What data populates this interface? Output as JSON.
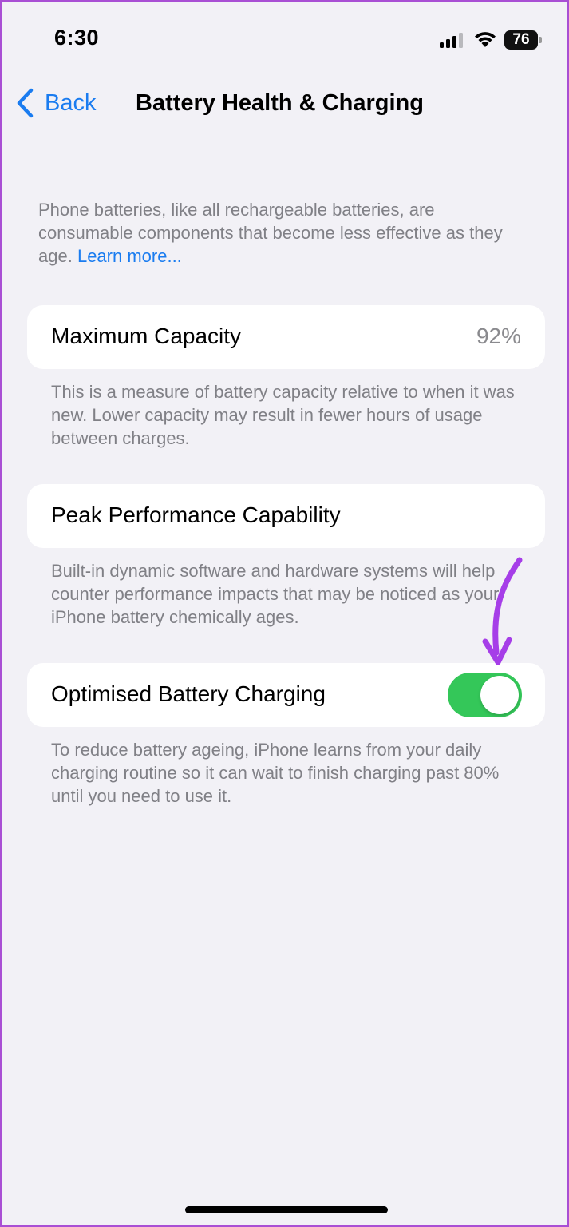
{
  "status_bar": {
    "time": "6:30",
    "battery_level": "76",
    "signal_icon": "cellular-signal-icon",
    "wifi_icon": "wifi-icon"
  },
  "nav": {
    "back_label": "Back",
    "title": "Battery Health & Charging",
    "back_icon": "chevron-left-icon"
  },
  "intro": {
    "text": "Phone batteries, like all rechargeable batteries, are consumable components that become less effective as they age.",
    "link": "Learn more..."
  },
  "max_capacity": {
    "label": "Maximum Capacity",
    "value": "92%",
    "footnote": "This is a measure of battery capacity relative to when it was new. Lower capacity may result in fewer hours of usage between charges."
  },
  "peak_performance": {
    "label": "Peak Performance Capability",
    "footnote": "Built-in dynamic software and hardware systems will help counter performance impacts that may be noticed as your iPhone battery chemically ages."
  },
  "optimised_charging": {
    "label": "Optimised Battery Charging",
    "enabled": true,
    "footnote": "To reduce battery ageing, iPhone learns from your daily charging routine so it can wait to finish charging past 80% until you need to use it."
  },
  "colors": {
    "accent": "#1a7cf0",
    "toggle_on": "#34c759",
    "annotation_arrow": "#a63ee8",
    "background": "#f2f1f6"
  }
}
